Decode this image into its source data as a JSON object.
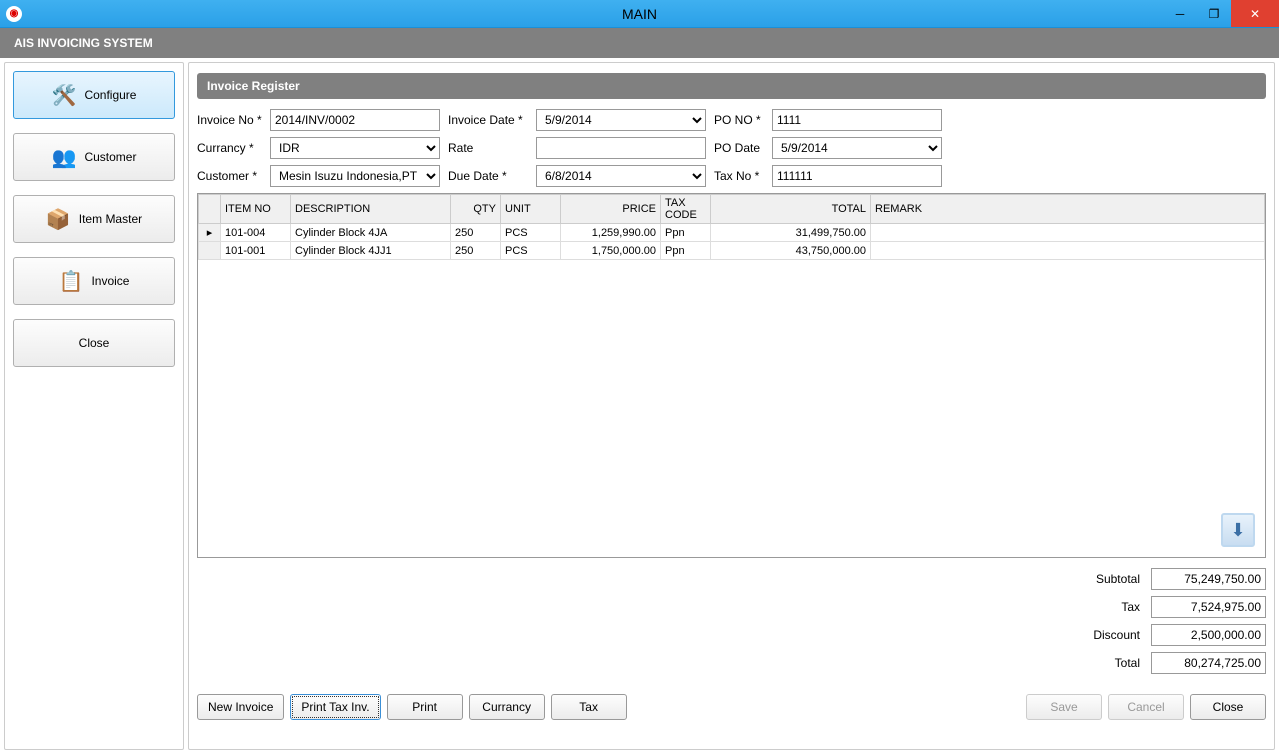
{
  "window": {
    "title": "MAIN",
    "app_icon": "◉"
  },
  "appbar": {
    "title": "AIS INVOICING SYSTEM"
  },
  "sidebar": {
    "items": [
      {
        "label": "Configure",
        "icon": "🛠️",
        "active": true
      },
      {
        "label": "Customer",
        "icon": "👥",
        "active": false
      },
      {
        "label": "Item Master",
        "icon": "📦",
        "active": false
      },
      {
        "label": "Invoice",
        "icon": "📋",
        "active": false
      },
      {
        "label": "Close",
        "icon": "",
        "active": false
      }
    ]
  },
  "panel": {
    "title": "Invoice Register"
  },
  "form": {
    "labels": {
      "invoice_no": "Invoice No *",
      "invoice_date": "Invoice Date *",
      "po_no": "PO NO *",
      "currency": "Currancy *",
      "rate": "Rate",
      "po_date": "PO Date",
      "customer": "Customer *",
      "due_date": "Due Date *",
      "tax_no": "Tax No *"
    },
    "values": {
      "invoice_no": "2014/INV/0002",
      "invoice_date": "5/9/2014",
      "po_no": "1111",
      "currency": "IDR",
      "rate": "",
      "po_date": "5/9/2014",
      "customer": "Mesin Isuzu Indonesia,PT",
      "due_date": "6/8/2014",
      "tax_no": "111111"
    }
  },
  "grid": {
    "headers": [
      "ITEM NO",
      "DESCRIPTION",
      "QTY",
      "UNIT",
      "PRICE",
      "TAX CODE",
      "TOTAL",
      "REMARK"
    ],
    "rows": [
      {
        "item_no": "101-004",
        "description": "Cylinder Block 4JA",
        "qty": "250",
        "unit": "PCS",
        "price": "1,259,990.00",
        "tax_code": "Ppn",
        "total": "31,499,750.00",
        "remark": "",
        "current": true
      },
      {
        "item_no": "101-001",
        "description": "Cylinder Block 4JJ1",
        "qty": "250",
        "unit": "PCS",
        "price": "1,750,000.00",
        "tax_code": "Ppn",
        "total": "43,750,000.00",
        "remark": "",
        "current": false
      }
    ]
  },
  "totals": {
    "labels": {
      "subtotal": "Subtotal",
      "tax": "Tax",
      "discount": "Discount",
      "total": "Total"
    },
    "values": {
      "subtotal": "75,249,750.00",
      "tax": "7,524,975.00",
      "discount": "2,500,000.00",
      "total": "80,274,725.00"
    }
  },
  "buttons": {
    "new_invoice": "New Invoice",
    "print_tax": "Print Tax Inv.",
    "print": "Print",
    "currency": "Currancy",
    "tax": "Tax",
    "save": "Save",
    "cancel": "Cancel",
    "close": "Close"
  }
}
